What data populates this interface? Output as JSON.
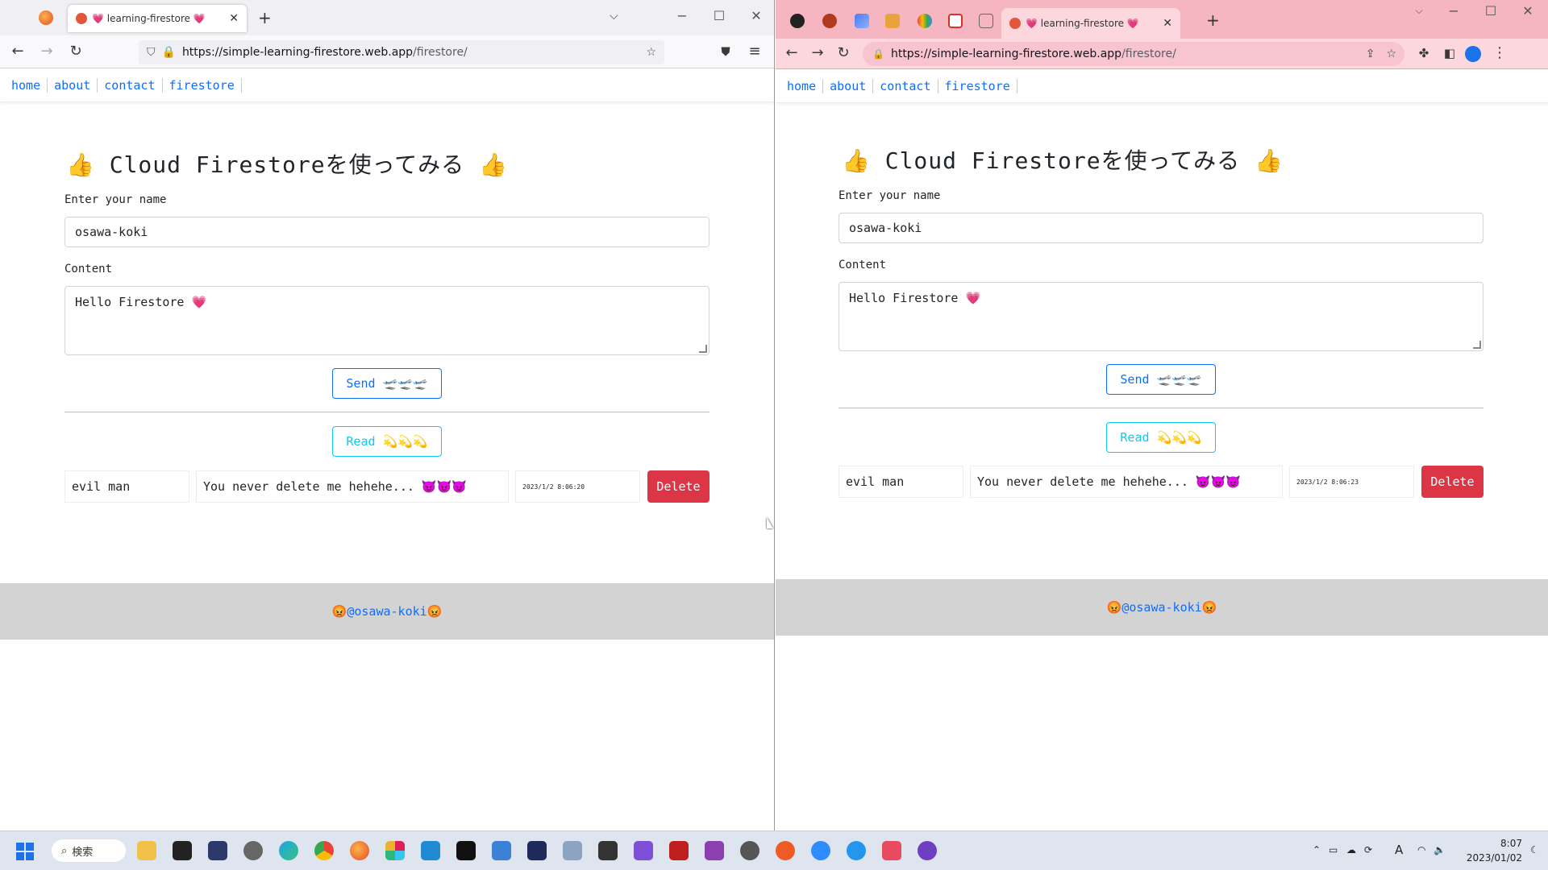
{
  "left_window": {
    "tab_title": "💗 learning-firestore 💗",
    "url_host": "https://simple-learning-firestore.web.app",
    "url_path": "/firestore/"
  },
  "right_window": {
    "tab_title": "💗 learning-firestore 💗",
    "url_host": "https://simple-learning-firestore.web.app",
    "url_path": "/firestore/"
  },
  "nav": {
    "home": "home",
    "about": "about",
    "contact": "contact",
    "firestore": "firestore"
  },
  "main": {
    "title": "👍 Cloud Firestoreを使ってみる 👍",
    "name_label": "Enter your name",
    "name_value": "osawa-koki",
    "content_label": "Content",
    "content_value": "Hello Firestore 💗",
    "send_label": "Send 🛫🛫🛫",
    "read_label": "Read 💫💫💫",
    "delete_label": "Delete"
  },
  "rows_left": [
    {
      "name": "evil man",
      "content": "You never delete me hehehe... 😈😈😈",
      "time": "2023/1/2 8:06:20"
    }
  ],
  "rows_right": [
    {
      "name": "evil man",
      "content": "You never delete me hehehe... 😈😈😈",
      "time": "2023/1/2 8:06:23"
    }
  ],
  "footer": {
    "pre": "😡",
    "link": "@osawa-koki",
    "post": "😡"
  },
  "taskbar": {
    "search": "検索",
    "time": "8:07",
    "date": "2023/01/02",
    "ime": "A"
  },
  "colors": {
    "primary": "#0d6efd",
    "info": "#0dcaf0",
    "danger": "#dc3545",
    "chrome_frame": "#f5b6c2"
  }
}
